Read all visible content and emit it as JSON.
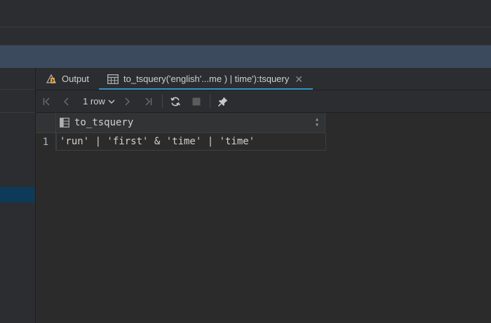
{
  "tabs": [
    {
      "label": "Output",
      "icon": "output-console-icon"
    },
    {
      "label": "to_tsquery('english'...me ) | time'):tsquery",
      "icon": "table-grid-icon",
      "active": true
    }
  ],
  "toolbar": {
    "rows_label": "1 row",
    "icons": [
      "first-page-icon",
      "prev-page-icon",
      "next-page-icon",
      "last-page-icon",
      "refresh-icon",
      "stop-icon",
      "pin-icon"
    ]
  },
  "grid": {
    "columns": [
      {
        "name": "to_tsquery"
      }
    ],
    "rows": [
      {
        "num": "1",
        "cells": [
          "'run' | 'first' & 'time' | 'time'"
        ]
      }
    ]
  },
  "colors": {
    "accent": "#3592c4",
    "selection": "#0d3a58",
    "background": "#2b2b2b"
  }
}
